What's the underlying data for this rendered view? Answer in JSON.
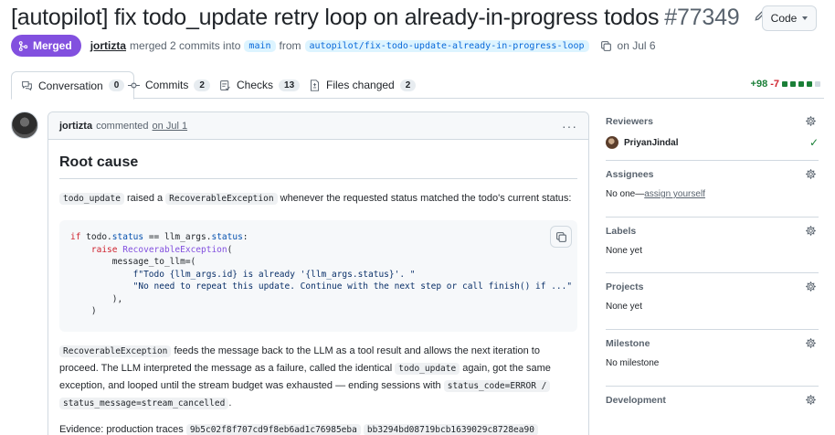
{
  "header": {
    "title": "[autopilot] fix todo_update retry loop on already-in-progress todos",
    "number": "#77349",
    "code_button": "Code"
  },
  "meta": {
    "status": "Merged",
    "author": "jortizta",
    "merged_text": "merged 2 commits into",
    "base_branch": "main",
    "from_text": "from",
    "head_branch": "autopilot/fix-todo-update-already-in-progress-loop",
    "date": "on Jul 6"
  },
  "tabs": [
    {
      "label": "Conversation",
      "count": "0"
    },
    {
      "label": "Commits",
      "count": "2"
    },
    {
      "label": "Checks",
      "count": "13"
    },
    {
      "label": "Files changed",
      "count": "2"
    }
  ],
  "diffstat": {
    "additions": "+98",
    "deletions": "-7"
  },
  "comment": {
    "author": "jortizta",
    "action": "commented",
    "when": "on Jul 1",
    "heading": "Root cause",
    "p1_code1": "todo_update",
    "p1_text1": " raised a ",
    "p1_code2": "RecoverableException",
    "p1_text2": " whenever the requested status matched the todo's current status:",
    "p2_code1": "RecoverableException",
    "p2_text1": " feeds the message back to the LLM as a tool result and allows the next iteration to proceed. The LLM interpreted the message as a failure, called the identical ",
    "p2_code2": "todo_update",
    "p2_text2": " again, got the same exception, and looped until the stream budget was exhausted — ending sessions with ",
    "p2_code3": "status_code=ERROR /",
    "p2_code4": "status_message=stream_cancelled",
    "p2_text3": ".",
    "p3_text": "Evidence: production traces ",
    "p3_code1": "9b5c02f8f707cd9f8eb6ad1c76985eba",
    "p3_code2": "bb3294bd08719bcb1639029c8728ea90"
  },
  "sidebar": {
    "reviewers": {
      "title": "Reviewers",
      "name": "PriyanJindal"
    },
    "assignees": {
      "title": "Assignees",
      "none": "No one—",
      "link": "assign yourself"
    },
    "labels": {
      "title": "Labels",
      "value": "None yet"
    },
    "projects": {
      "title": "Projects",
      "value": "None yet"
    },
    "milestone": {
      "title": "Milestone",
      "value": "No milestone"
    },
    "development": {
      "title": "Development"
    }
  },
  "colors": {
    "merged": "#8250df",
    "add": "#1a7f37",
    "del": "#d1242f",
    "link": "#0969da"
  }
}
